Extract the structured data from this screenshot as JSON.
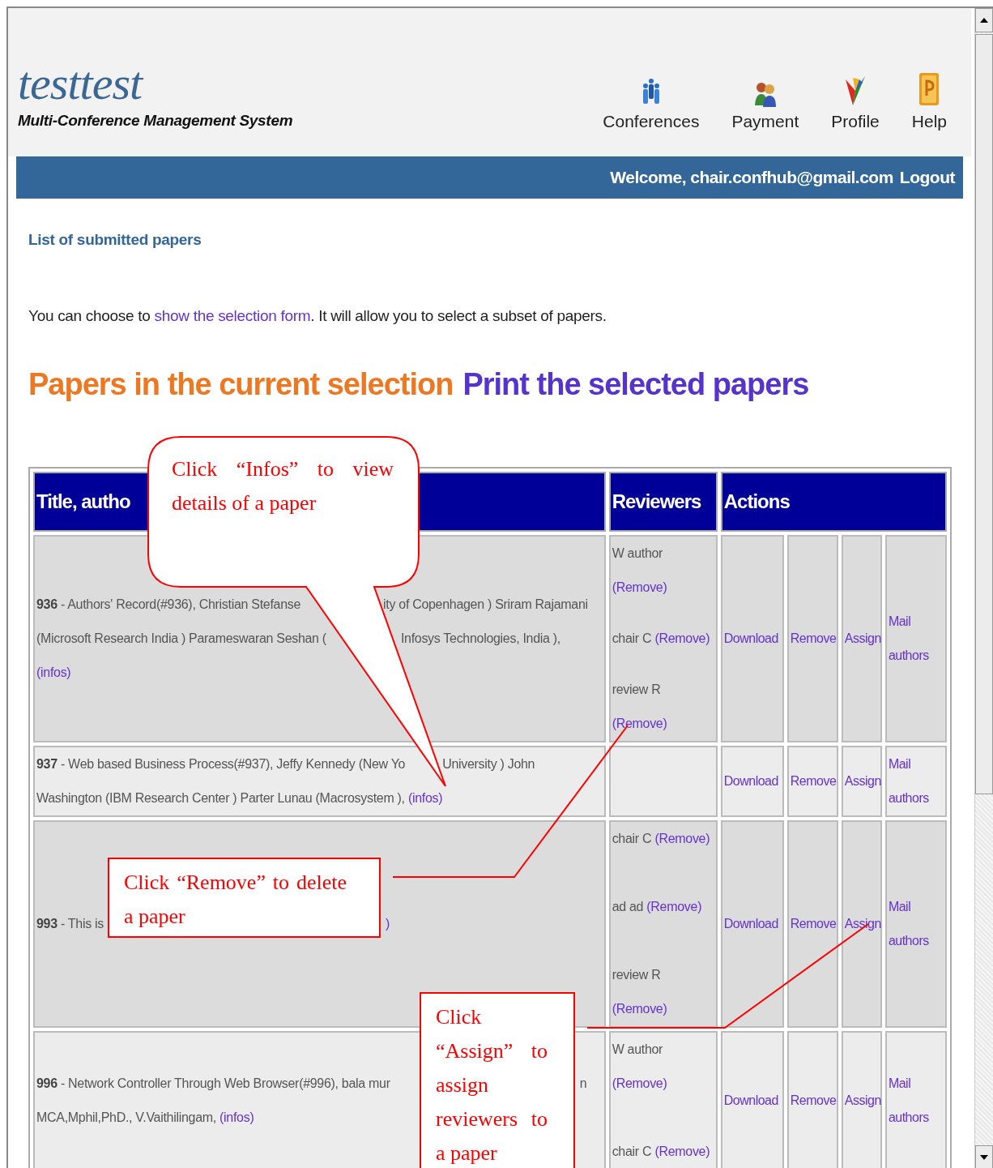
{
  "site": {
    "title": "testtest",
    "subtitle": "Multi-Conference Management System"
  },
  "nav": [
    {
      "label": "Conferences",
      "kind": "people"
    },
    {
      "label": "Payment",
      "kind": "pair"
    },
    {
      "label": "Profile",
      "kind": "vshape"
    },
    {
      "label": "Help",
      "kind": "tile"
    }
  ],
  "welcome_bar": {
    "text": "Welcome, chair.confhub@gmail.com",
    "link": "Logout"
  },
  "page_title": "List of submitted papers",
  "intro": {
    "before": "You can choose to",
    "link": "show the selection form",
    "after": ". It will allow you to select a subset of papers."
  },
  "selection_heading": {
    "text": "Papers in the current selection",
    "link": "Print the selected papers"
  },
  "table": {
    "columns": [
      "Title, autho",
      "Reviewers",
      "Actions"
    ],
    "rows": [
      {
        "lines": [
          [
            {
              "text": "**936** - Authors' Record(#936), Christian Stefanse"
            },
            {
              "text": "ity of Copenhagen ) Sriram Rajamani"
            }
          ],
          [
            {
              "text": "(Microsoft Research India ) Parameswaran Seshan ("
            },
            {
              "text": "Infosys Technologies, India ),"
            }
          ],
          [
            {
              "link": "(infos)"
            }
          ]
        ],
        "reviewers": [
          {
            "name": "W author",
            "link": "(Remove)"
          },
          {
            "name": "chair C",
            "link": "(Remove)"
          },
          {
            "name": "review R",
            "link": "(Remove)"
          }
        ],
        "actions": [
          "Download",
          "Remove",
          "Assign",
          "Mail authors"
        ]
      },
      {
        "lines": [
          [
            {
              "text": "**937** - Web based Business Process(#937), Jeffy Kennedy (New Yo"
            },
            {
              "text": "University ) John"
            }
          ],
          [
            {
              "text": "Washington (IBM Research Center ) Parter Lunau (Macrosystem ),",
              "link": "(infos)"
            }
          ]
        ],
        "actions": [
          "Download",
          "Remove",
          "Assign",
          "Mail authors"
        ]
      },
      {
        "lines": [
          [
            {
              "text": "**993** - This is"
            },
            {
              "link": ")"
            }
          ]
        ],
        "reviewers": [
          {
            "name": "chair C",
            "link": "(Remove)"
          },
          {
            "name": "ad ad",
            "link": "(Remove)"
          },
          {
            "name": "review R",
            "link": "(Remove)"
          }
        ],
        "actions": [
          "Download",
          "Remove",
          "Assign",
          "Mail authors"
        ]
      },
      {
        "lines": [
          [
            {
              "text": "**996** - Network Controller Through Web Browser(#996), bala mur"
            },
            {
              "text": "n"
            }
          ],
          [
            {
              "text": "MCA,Mphil,PhD., V.Vaithilingam,",
              "link": "(infos)"
            }
          ]
        ],
        "reviewers": [
          {
            "name": "W author",
            "link": "(Remove)"
          },
          {
            "name": "chair C",
            "link": "(Remove)"
          }
        ],
        "actions": [
          "Download",
          "Remove",
          "Assign",
          "Mail authors"
        ]
      }
    ]
  },
  "callouts": [
    {
      "kind": "bubble",
      "text": "Click “Infos” to view details of a paper"
    },
    {
      "kind": "box",
      "text": "Click “Remove” to delete a paper"
    },
    {
      "kind": "box",
      "text": "Click “Assign” to assign reviewers to a paper"
    }
  ]
}
